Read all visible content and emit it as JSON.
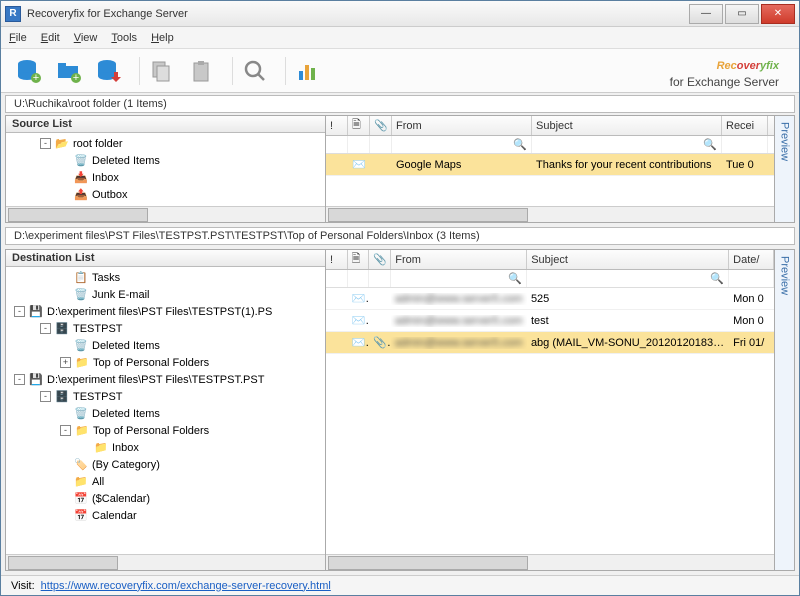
{
  "window": {
    "title": "Recoveryfix for Exchange Server"
  },
  "menu": {
    "file": "File",
    "edit": "Edit",
    "view": "View",
    "tools": "Tools",
    "help": "Help"
  },
  "brand": {
    "name": "Recoveryfix",
    "sub": "for Exchange Server"
  },
  "path_top": "U:\\Ruchika\\root folder   (1 Items)",
  "path_bottom": "D:\\experiment files\\PST Files\\TESTPST.PST\\TESTPST\\Top of Personal Folders\\Inbox   (3 Items)",
  "source": {
    "title": "Source List",
    "tree": [
      {
        "indent": 1,
        "exp": "-",
        "icon": "root",
        "label": "root folder"
      },
      {
        "indent": 2,
        "exp": "",
        "icon": "deleted",
        "label": "Deleted Items"
      },
      {
        "indent": 2,
        "exp": "",
        "icon": "inbox",
        "label": "Inbox"
      },
      {
        "indent": 2,
        "exp": "",
        "icon": "outbox",
        "label": "Outbox"
      }
    ]
  },
  "dest": {
    "title": "Destination List",
    "tree": [
      {
        "indent": 2,
        "exp": "",
        "icon": "tasks",
        "label": "Tasks"
      },
      {
        "indent": 2,
        "exp": "",
        "icon": "junk",
        "label": "Junk E-mail"
      },
      {
        "indent": 0,
        "exp": "-",
        "icon": "pst",
        "label": "D:\\experiment files\\PST Files\\TESTPST(1).PS"
      },
      {
        "indent": 1,
        "exp": "-",
        "icon": "store",
        "label": "TESTPST"
      },
      {
        "indent": 2,
        "exp": "",
        "icon": "deleted",
        "label": "Deleted Items"
      },
      {
        "indent": 2,
        "exp": "+",
        "icon": "folder",
        "label": "Top of Personal Folders"
      },
      {
        "indent": 0,
        "exp": "-",
        "icon": "pst",
        "label": "D:\\experiment files\\PST Files\\TESTPST.PST"
      },
      {
        "indent": 1,
        "exp": "-",
        "icon": "store",
        "label": "TESTPST"
      },
      {
        "indent": 2,
        "exp": "",
        "icon": "deleted",
        "label": "Deleted Items"
      },
      {
        "indent": 2,
        "exp": "-",
        "icon": "folder",
        "label": "Top of Personal Folders"
      },
      {
        "indent": 3,
        "exp": "",
        "icon": "folder",
        "label": "Inbox"
      },
      {
        "indent": 2,
        "exp": "",
        "icon": "category",
        "label": "(By Category)"
      },
      {
        "indent": 2,
        "exp": "",
        "icon": "folder",
        "label": "All"
      },
      {
        "indent": 2,
        "exp": "",
        "icon": "calendar",
        "label": "($Calendar)"
      },
      {
        "indent": 2,
        "exp": "",
        "icon": "calendar",
        "label": "Calendar"
      }
    ]
  },
  "list_top": {
    "columns": {
      "flag": "!",
      "doc": "🗎",
      "att": "📎",
      "from": "From",
      "subject": "Subject",
      "date": "Recei"
    },
    "rows": [
      {
        "selected": true,
        "from": "Google Maps",
        "subject": "Thanks for your recent contributions",
        "date": "Tue 0",
        "att": false
      }
    ]
  },
  "list_bottom": {
    "columns": {
      "flag": "!",
      "doc": "🗎",
      "att": "📎",
      "from": "From",
      "subject": "Subject",
      "date": "Date/"
    },
    "rows": [
      {
        "selected": false,
        "from_blur": true,
        "from": "admin@www.server5.com",
        "subject": "525",
        "date": "Mon 0",
        "att": false
      },
      {
        "selected": false,
        "from_blur": true,
        "from": "admin@www.server5.com",
        "subject": "test",
        "date": "Mon 0",
        "att": false
      },
      {
        "selected": true,
        "from_blur": true,
        "from": "admin@www.server5.com",
        "subject": "abg (MAIL_VM-SONU_201201201837...",
        "date": "Fri 01/",
        "att": true
      }
    ]
  },
  "preview_label": "Preview",
  "footer": {
    "visit": "Visit:",
    "url": "https://www.recoveryfix.com/exchange-server-recovery.html"
  },
  "icons": {
    "db_add": "db-add",
    "folder_add": "folder-add",
    "db_down": "db-down",
    "copy": "copy",
    "clip": "clipboard",
    "search": "search",
    "chart": "chart"
  }
}
